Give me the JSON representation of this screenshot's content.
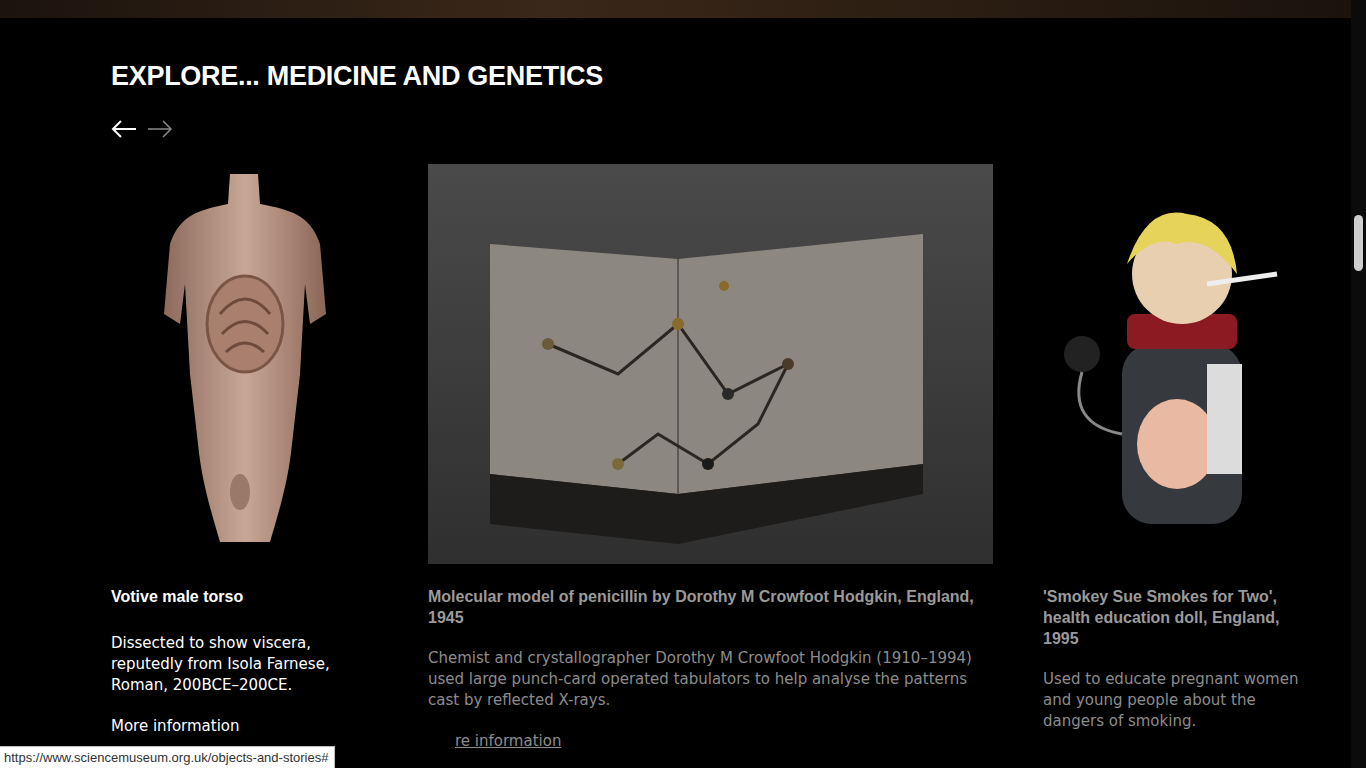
{
  "section": {
    "title": "EXPLORE... MEDICINE AND GENETICS"
  },
  "nav": {
    "prev_enabled": true,
    "next_enabled": false
  },
  "cards": [
    {
      "kind": "torso",
      "active": true,
      "title": "Votive male torso",
      "description": "Dissected to show viscera, reputedly from Isola Farnese, Roman, 200BCE–200CE.",
      "link": "More information"
    },
    {
      "kind": "model",
      "active": false,
      "title": "Molecular model of penicillin by Dorothy M Crowfoot Hodgkin, England, 1945",
      "description": "Chemist and crystallographer Dorothy M Crowfoot Hodgkin (1910–1994) used large punch-card operated tabulators to help analyse the patterns cast by reflected X-rays.",
      "link": "re information"
    },
    {
      "kind": "doll",
      "active": false,
      "title": "'Smokey Sue Smokes for Two', health education doll, England, 1995",
      "description": "Used to educate pregnant women and young people about the dangers of smoking."
    }
  ],
  "status_bar": {
    "url": "https://www.sciencemuseum.org.uk/objects-and-stories#"
  },
  "scrollbar": {
    "level": 0.28
  }
}
